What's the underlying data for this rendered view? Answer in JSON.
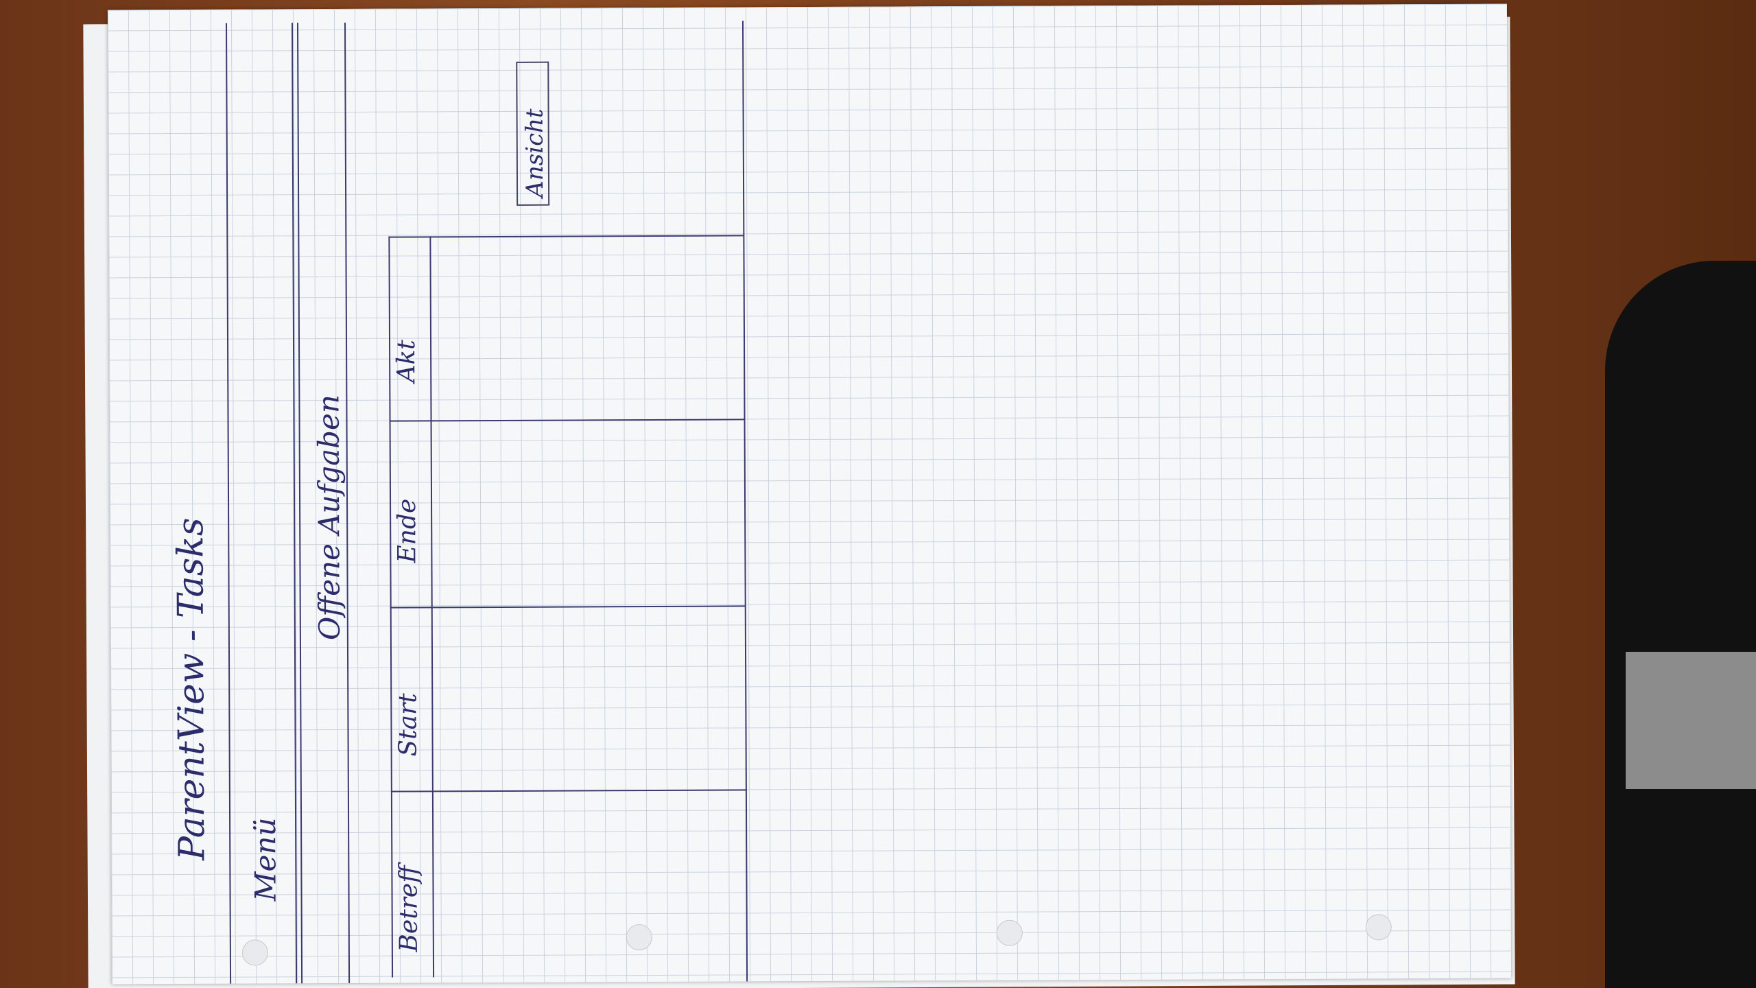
{
  "header": {
    "title": "ParentView - Tasks"
  },
  "menu": {
    "label": "Menü"
  },
  "section": {
    "heading": "Offene Aufgaben"
  },
  "table": {
    "columns": [
      "Betreff",
      "Start",
      "Ende",
      "Akt"
    ]
  },
  "actions": {
    "view_button_label": "Ansicht"
  },
  "colors": {
    "ink": "#2c2c6a",
    "paper": "#f6f7f9",
    "grid": "#c9d3df",
    "desk": "#7a3f1f"
  }
}
